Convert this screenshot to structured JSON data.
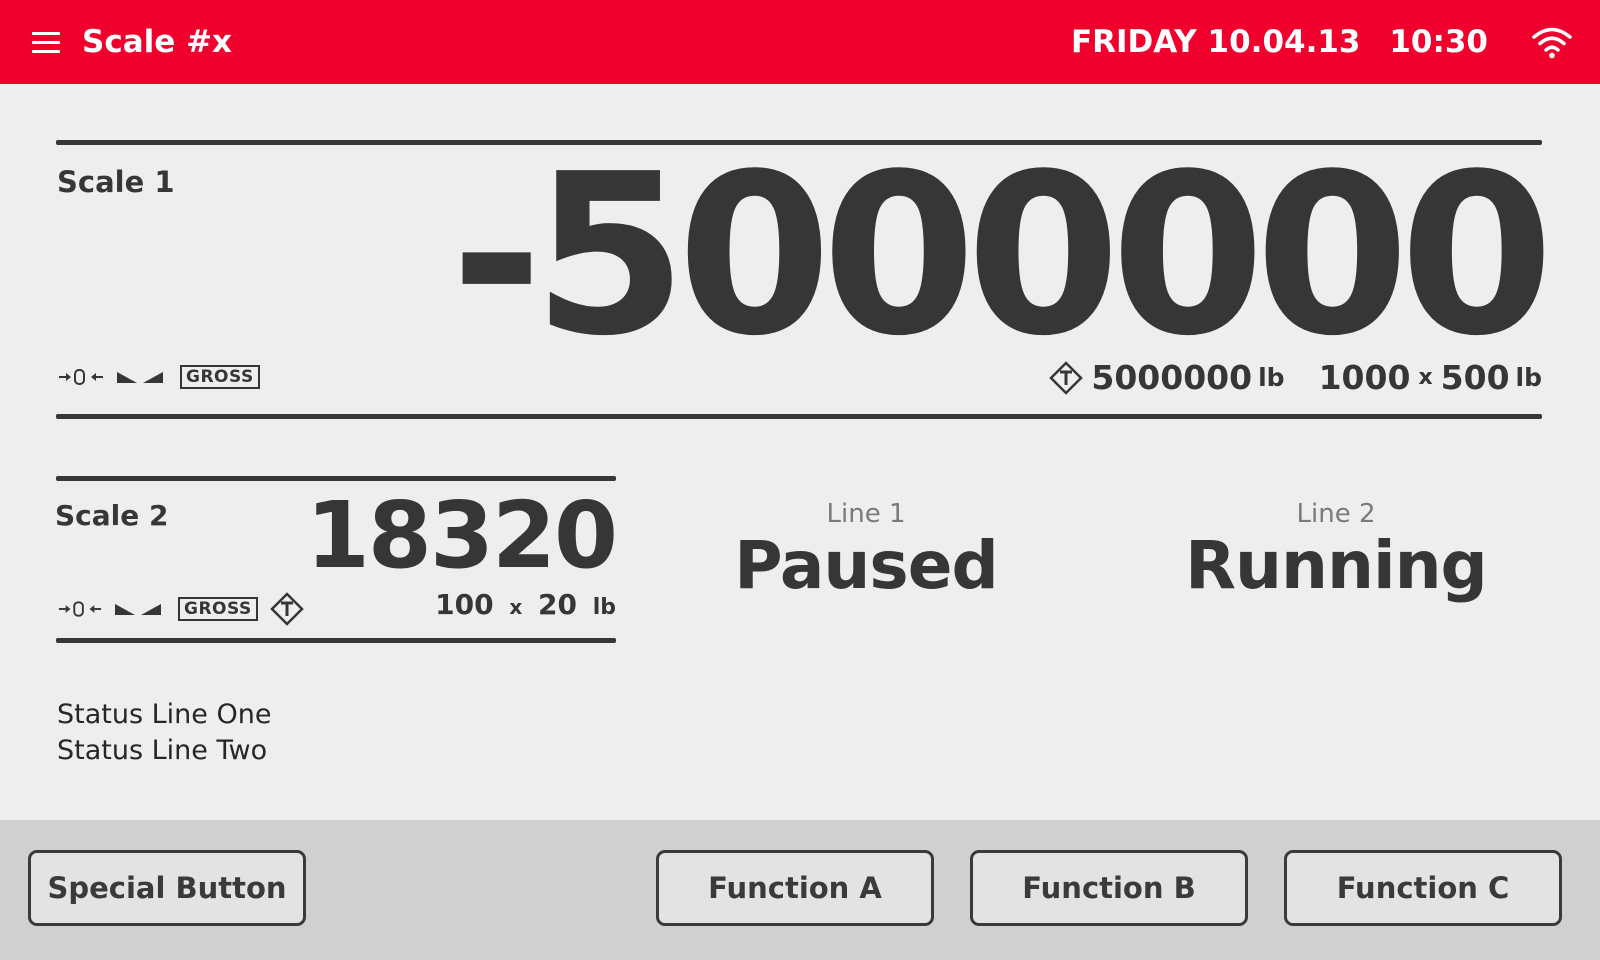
{
  "header": {
    "title": "Scale #x",
    "day": "FRIDAY",
    "date": "10.04.13",
    "time": "10:30",
    "menu_icon": "hamburger-menu-icon",
    "wifi_icon": "wifi-icon"
  },
  "colors": {
    "header_bg": "#f0002d",
    "page_bg": "#efeeef",
    "text": "#363636",
    "bottom_bar_bg": "#d1d0d1"
  },
  "scale1": {
    "label": "Scale 1",
    "value": "-5000000",
    "gross_label": "GROSS",
    "capacity": "5000000",
    "capacity_unit": "lb",
    "div_count": "1000",
    "div_x": "x",
    "div_value": "500",
    "div_unit": "lb",
    "icons": [
      "zero-icon",
      "stable-icon",
      "gross-badge",
      "tare-icon"
    ]
  },
  "scale2": {
    "label": "Scale 2",
    "value": "18320",
    "gross_label": "GROSS",
    "div_count": "100",
    "div_x": "x",
    "div_value": "20",
    "div_unit": "lb",
    "icons": [
      "zero-icon",
      "stable-icon",
      "gross-badge",
      "tare-icon"
    ]
  },
  "lines": [
    {
      "title": "Line 1",
      "status": "Paused"
    },
    {
      "title": "Line 2",
      "status": "Running"
    }
  ],
  "status_lines": [
    "Status Line One",
    "Status Line Two"
  ],
  "buttons": {
    "special": "Special Button",
    "function_a": "Function A",
    "function_b": "Function B",
    "function_c": "Function C"
  }
}
